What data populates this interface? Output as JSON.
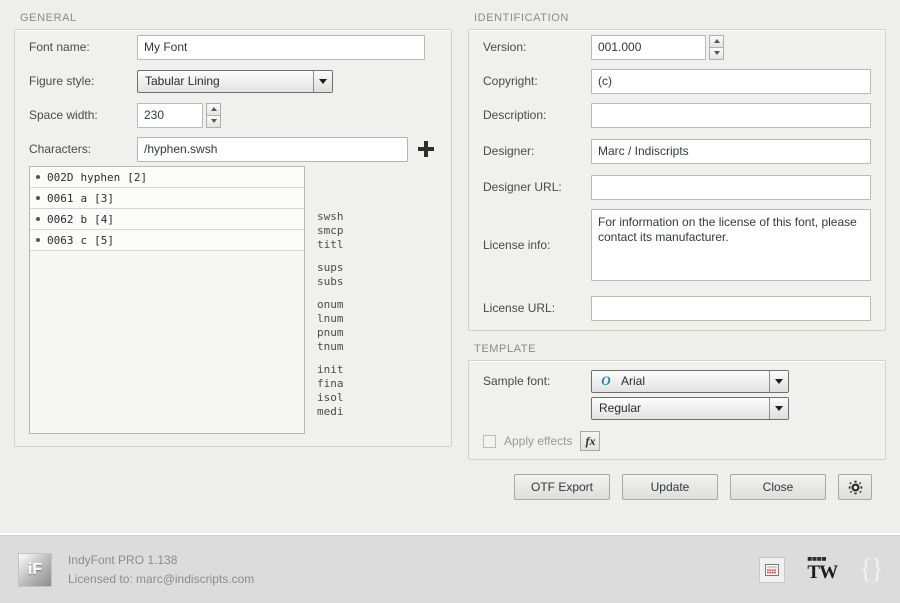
{
  "general": {
    "title": "GENERAL",
    "font_name_label": "Font name:",
    "font_name_value": "My Font",
    "figure_style_label": "Figure style:",
    "figure_style_value": "Tabular Lining",
    "space_width_label": "Space width:",
    "space_width_value": "230",
    "characters_label": "Characters:",
    "characters_value": "/hyphen.swsh",
    "add_icon": "plus-icon",
    "char_list": [
      {
        "code": "002D",
        "name": "hyphen",
        "index": "[2]"
      },
      {
        "code": "0061",
        "name": "a",
        "index": "[3]"
      },
      {
        "code": "0062",
        "name": "b",
        "index": "[4]"
      },
      {
        "code": "0063",
        "name": "c",
        "index": "[5]"
      }
    ],
    "feature_tag_groups": [
      [
        "swsh",
        "smcp",
        "titl"
      ],
      [
        "sups",
        "subs"
      ],
      [
        "onum",
        "lnum",
        "pnum",
        "tnum"
      ],
      [
        "init",
        "fina",
        "isol",
        "medi"
      ]
    ]
  },
  "identification": {
    "title": "IDENTIFICATION",
    "version_label": "Version:",
    "version_value": "001.000",
    "copyright_label": "Copyright:",
    "copyright_value": "(c)",
    "description_label": "Description:",
    "description_value": "",
    "designer_label": "Designer:",
    "designer_value": "Marc / Indiscripts",
    "designer_url_label": "Designer URL:",
    "designer_url_value": "",
    "license_info_label": "License info:",
    "license_info_value": "For information on the license of this font, please contact its manufacturer.",
    "license_url_label": "License URL:",
    "license_url_value": ""
  },
  "template": {
    "title": "TEMPLATE",
    "sample_font_label": "Sample font:",
    "sample_font_value": "Arial",
    "sample_font_icon": "opentype-o-icon",
    "sample_style_value": "Regular",
    "apply_effects_label": "Apply effects",
    "fx_label": "fx"
  },
  "actions": {
    "otf_export": "OTF Export",
    "update": "Update",
    "close": "Close",
    "settings_icon": "gear-icon"
  },
  "footer": {
    "logo_text": "iF",
    "app_name": "IndyFont PRO  1.138",
    "license_line": "Licensed to: marc@indiscripts.com",
    "icons": [
      "keyboard-icon",
      "tw-logo",
      "braces-logo"
    ],
    "tw_text": "TW",
    "brace_text": "{}"
  },
  "colors": {
    "background": "#eeeeea",
    "footer": "#dcdcdc",
    "accent": "#1a8fa0",
    "focus_border": "#93bddd"
  }
}
